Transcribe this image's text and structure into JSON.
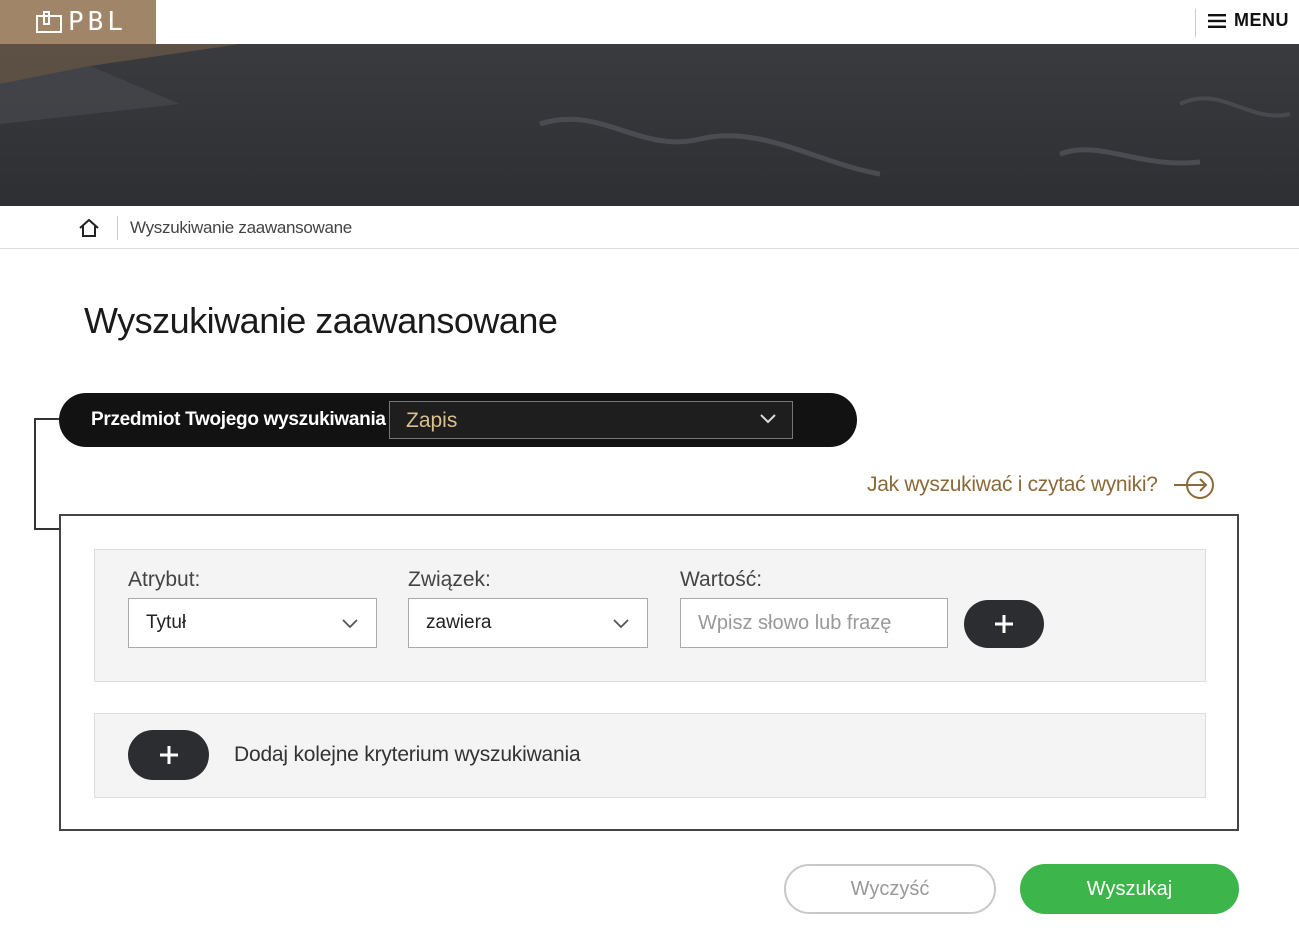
{
  "header": {
    "logo_text": "PBL",
    "menu_label": "MENU"
  },
  "breadcrumb": {
    "current": "Wyszukiwanie zaawansowane"
  },
  "page": {
    "title": "Wyszukiwanie zaawansowane"
  },
  "subject": {
    "label": "Przedmiot Twojego wyszukiwania",
    "selected": "Zapis"
  },
  "help": {
    "link_text": "Jak wyszukiwać i czytać wyniki?"
  },
  "criteria": {
    "attribute_label": "Atrybut:",
    "attribute_value": "Tytuł",
    "relation_label": "Związek:",
    "relation_value": "zawiera",
    "value_label": "Wartość:",
    "value_placeholder": "Wpisz słowo lub frazę",
    "value_current": ""
  },
  "add_criterion": {
    "label": "Dodaj kolejne kryterium wyszukiwania"
  },
  "actions": {
    "clear_label": "Wyczyść",
    "search_label": "Wyszukaj"
  },
  "colors": {
    "logo_bg": "#a08569",
    "subject_bar": "#121212",
    "subject_value": "#d9c08c",
    "help_link": "#8b6a3a",
    "search_button": "#3cb54a",
    "pill_button": "#2b2d31"
  }
}
